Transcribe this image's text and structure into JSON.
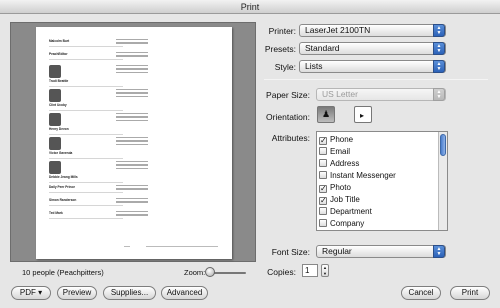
{
  "window": {
    "title": "Print"
  },
  "preview": {
    "info": "10 people (Peachpitters)",
    "zoom_label": "Zoom:",
    "entries": [
      {
        "name": "Malcolm Burt",
        "photo": false
      },
      {
        "name": "PeachEditor",
        "photo": false
      },
      {
        "name": "Trudi Beattie",
        "photo": true
      },
      {
        "name": "Clint Ucoby",
        "photo": true
      },
      {
        "name": "Henry Devon",
        "photo": true
      },
      {
        "name": "Victor Gavenda",
        "photo": true
      },
      {
        "name": "Debbie Jeang Mills",
        "photo": true
      },
      {
        "name": "Daily Peer Prince",
        "photo": false
      },
      {
        "name": "Simon Randerson",
        "photo": false
      },
      {
        "name": "Ted Mark",
        "photo": false
      }
    ]
  },
  "settings": {
    "printer": {
      "label": "Printer:",
      "value": "LaserJet 2100TN"
    },
    "presets": {
      "label": "Presets:",
      "value": "Standard"
    },
    "style": {
      "label": "Style:",
      "value": "Lists"
    },
    "paper_size": {
      "label": "Paper Size:",
      "value": "US Letter"
    },
    "orientation": {
      "label": "Orientation:",
      "selected": "portrait"
    },
    "attributes": {
      "label": "Attributes:",
      "items": [
        {
          "label": "Phone",
          "checked": true
        },
        {
          "label": "Email",
          "checked": false
        },
        {
          "label": "Address",
          "checked": false
        },
        {
          "label": "Instant Messenger",
          "checked": false
        },
        {
          "label": "Photo",
          "checked": true
        },
        {
          "label": "Job Title",
          "checked": true
        },
        {
          "label": "Department",
          "checked": false
        },
        {
          "label": "Company",
          "checked": false
        }
      ]
    },
    "font_size": {
      "label": "Font Size:",
      "value": "Regular"
    },
    "copies": {
      "label": "Copies:",
      "value": "1"
    }
  },
  "buttons": {
    "pdf": "PDF ▾",
    "preview": "Preview",
    "supplies": "Supplies...",
    "advanced": "Advanced",
    "cancel": "Cancel",
    "print": "Print"
  },
  "colors": {
    "accent": "#2c62b8",
    "preview_bg": "#8a8a8a"
  }
}
